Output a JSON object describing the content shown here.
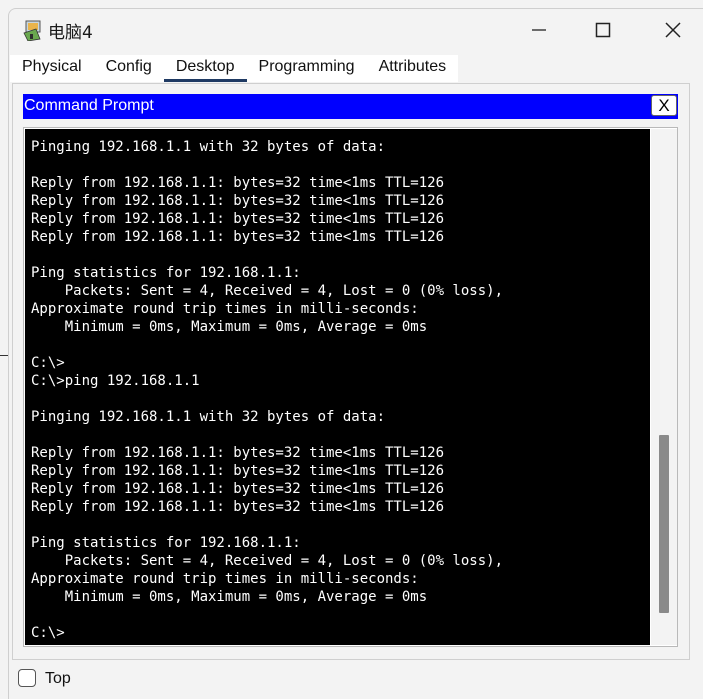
{
  "window": {
    "title": "电脑4",
    "icon": "pc-device-icon"
  },
  "tabs": [
    {
      "label": "Physical"
    },
    {
      "label": "Config"
    },
    {
      "label": "Desktop",
      "active": true
    },
    {
      "label": "Programming"
    },
    {
      "label": "Attributes"
    }
  ],
  "command_prompt": {
    "title": "Command Prompt",
    "close_label": "X",
    "title_bar_color": "#0000ff",
    "output": "Pinging 192.168.1.1 with 32 bytes of data:\n\nReply from 192.168.1.1: bytes=32 time<1ms TTL=126\nReply from 192.168.1.1: bytes=32 time<1ms TTL=126\nReply from 192.168.1.1: bytes=32 time<1ms TTL=126\nReply from 192.168.1.1: bytes=32 time<1ms TTL=126\n\nPing statistics for 192.168.1.1:\n    Packets: Sent = 4, Received = 4, Lost = 0 (0% loss),\nApproximate round trip times in milli-seconds:\n    Minimum = 0ms, Maximum = 0ms, Average = 0ms\n\nC:\\>\nC:\\>ping 192.168.1.1\n\nPinging 192.168.1.1 with 32 bytes of data:\n\nReply from 192.168.1.1: bytes=32 time<1ms TTL=126\nReply from 192.168.1.1: bytes=32 time<1ms TTL=126\nReply from 192.168.1.1: bytes=32 time<1ms TTL=126\nReply from 192.168.1.1: bytes=32 time<1ms TTL=126\n\nPing statistics for 192.168.1.1:\n    Packets: Sent = 4, Received = 4, Lost = 0 (0% loss),\nApproximate round trip times in milli-seconds:\n    Minimum = 0ms, Maximum = 0ms, Average = 0ms\n\nC:\\>"
  },
  "footer": {
    "top_checkbox_label": "Top",
    "top_checked": false
  }
}
